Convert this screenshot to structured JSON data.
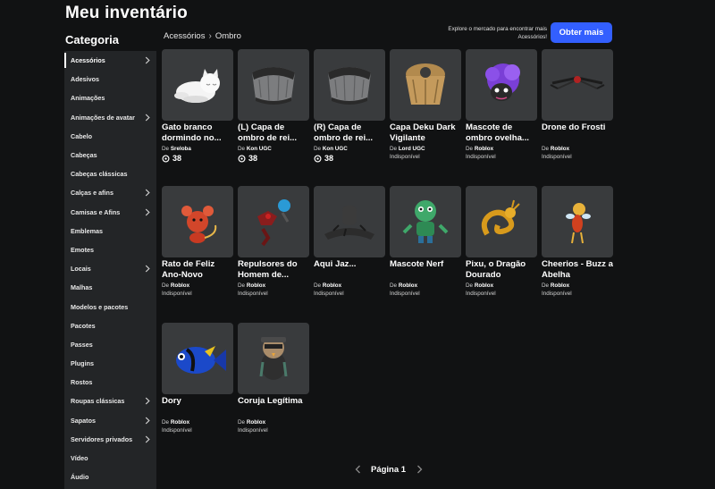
{
  "page": {
    "title": "Meu inventário",
    "category_heading": "Categoria",
    "promo_text": "Explore o mercado para encontrar mais Acessórios!",
    "get_more_label": "Obter mais",
    "accent_color": "#335fff"
  },
  "breadcrumb": {
    "root": "Acessórios",
    "current": "Ombro"
  },
  "sidebar": {
    "items": [
      {
        "label": "Acessórios",
        "chevron": true,
        "active": true
      },
      {
        "label": "Adesivos",
        "chevron": false
      },
      {
        "label": "Animações",
        "chevron": false
      },
      {
        "label": "Animações de avatar",
        "chevron": true
      },
      {
        "label": "Cabelo",
        "chevron": false
      },
      {
        "label": "Cabeças",
        "chevron": false
      },
      {
        "label": "Cabeças clássicas",
        "chevron": false
      },
      {
        "label": "Calças e afins",
        "chevron": true
      },
      {
        "label": "Camisas e Afins",
        "chevron": true
      },
      {
        "label": "Emblemas",
        "chevron": false
      },
      {
        "label": "Emotes",
        "chevron": false
      },
      {
        "label": "Locais",
        "chevron": true
      },
      {
        "label": "Malhas",
        "chevron": false
      },
      {
        "label": "Modelos e pacotes",
        "chevron": false
      },
      {
        "label": "Pacotes",
        "chevron": false
      },
      {
        "label": "Passes",
        "chevron": false
      },
      {
        "label": "Plugins",
        "chevron": false
      },
      {
        "label": "Rostos",
        "chevron": false
      },
      {
        "label": "Roupas clássicas",
        "chevron": true
      },
      {
        "label": "Sapatos",
        "chevron": true
      },
      {
        "label": "Servidores privados",
        "chevron": true
      },
      {
        "label": "Vídeo",
        "chevron": false
      },
      {
        "label": "Áudio",
        "chevron": false
      }
    ]
  },
  "items": [
    {
      "name": "Gato branco dormindo no...",
      "by": "De",
      "creator": "Sreloba",
      "price": "38",
      "icon": "white-cat-icon"
    },
    {
      "name": "(L) Capa de ombro de rei...",
      "by": "De",
      "creator": "Kon UGC",
      "price": "38",
      "icon": "shoulder-cape-icon"
    },
    {
      "name": "(R) Capa de ombro de rei...",
      "by": "De",
      "creator": "Kon UGC",
      "price": "38",
      "icon": "shoulder-cape-icon"
    },
    {
      "name": "Capa Deku Dark Vigilante",
      "by": "De",
      "creator": "Lord UGC",
      "status": "Indisponível",
      "icon": "deku-cape-icon"
    },
    {
      "name": "Mascote de ombro ovelha...",
      "by": "De",
      "creator": "Roblox",
      "status": "Indisponível",
      "icon": "sheep-mascot-icon"
    },
    {
      "name": "Drone do Frosti",
      "by": "De",
      "creator": "Roblox",
      "status": "Indisponível",
      "icon": "drone-icon"
    },
    {
      "name": "Rato de Feliz Ano-Novo",
      "by": "De",
      "creator": "Roblox",
      "status": "Indisponível",
      "icon": "rat-icon"
    },
    {
      "name": "Repulsores do Homem de...",
      "by": "De",
      "creator": "Roblox",
      "status": "Indisponível",
      "icon": "repulsor-icon"
    },
    {
      "name": "Aqui Jaz...",
      "by": "De",
      "creator": "Roblox",
      "status": "Indisponível",
      "icon": "tombstone-icon"
    },
    {
      "name": "Mascote Nerf",
      "by": "De",
      "creator": "Roblox",
      "status": "Indisponível",
      "icon": "nerf-mascot-icon"
    },
    {
      "name": "Pixu, o Dragão Dourado",
      "by": "De",
      "creator": "Roblox",
      "status": "Indisponível",
      "icon": "golden-dragon-icon"
    },
    {
      "name": "Cheerios - Buzz a Abelha",
      "by": "De",
      "creator": "Roblox",
      "status": "Indisponível",
      "icon": "bee-icon"
    },
    {
      "name": "Dory",
      "by": "De",
      "creator": "Roblox",
      "status": "Indisponível",
      "icon": "fish-icon"
    },
    {
      "name": "Coruja Legítima",
      "by": "De",
      "creator": "Roblox",
      "status": "Indisponível",
      "icon": "owl-icon"
    }
  ],
  "pagination": {
    "label": "Página 1"
  }
}
